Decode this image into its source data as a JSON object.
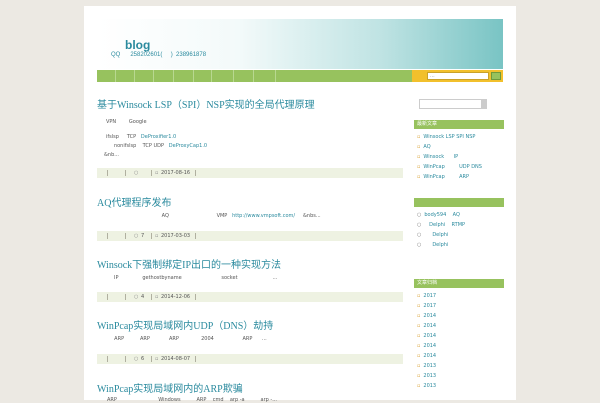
{
  "header": {
    "title": "blog",
    "subtitle": "QQ      258202601(     )  238961878"
  },
  "nav": {
    "search_placeholder": "..."
  },
  "posts": [
    {
      "title": "基于Winsock LSP（SPI）NSP实现的全局代理原理",
      "lines": [
        {
          "text": "VPN        Google",
          "link": ""
        },
        {
          "text": "ifslsp     TCP   ",
          "link": "DeProxifier1.0"
        },
        {
          "text": "     nonifslsp    TCP UDP   ",
          "link": "DeProxyCap1.0"
        },
        {
          "text": "&nb...",
          "link": ""
        }
      ],
      "comments": "",
      "date": "2017-08-16"
    },
    {
      "title": "AQ代理程序发布",
      "lines": [
        {
          "text": "                                   AQ                              VMP   ",
          "link": "http://www.vmpsoft.com/",
          "after": "     &nbs..."
        }
      ],
      "comments": "7",
      "date": "2017-03-03"
    },
    {
      "title": "Winsock下强制绑定IP出口的一种实现方法",
      "lines": [
        {
          "text": "IP               gethostbyname                         socket                      ...",
          "link": ""
        }
      ],
      "comments": "4",
      "date": "2014-12-06"
    },
    {
      "title": "WinPcap实现局域网内UDP（DNS）劫持",
      "lines": [
        {
          "text": "  ARP          ARP            ARP              2004                  ARP      ...",
          "link": ""
        }
      ],
      "comments": "6",
      "date": "2014-08-07"
    },
    {
      "title": "WinPcap实现局域网内的ARP欺骗",
      "lines": [
        {
          "text": "ARP                          Windows          ARP    cmd    arp -a          arp -...",
          "link": ""
        }
      ],
      "comments": "",
      "date": ""
    }
  ],
  "sidebar": {
    "section1": {
      "title": "最新文章",
      "items": [
        "Winsock LSP SPI NSP",
        "AQ",
        "Winsock      IP",
        "WinPcap         UDP DNS",
        "WinPcap         ARP"
      ]
    },
    "section2": {
      "items": [
        "body594    AQ",
        "   Delphi    RTMP",
        "     Delphi",
        "     Delphi"
      ]
    },
    "section3": {
      "title": "文章归档",
      "items": [
        "2017",
        "2017",
        "2014",
        "2014",
        "2014",
        "2014",
        "2014",
        "2013",
        "2013",
        "2013"
      ]
    }
  }
}
